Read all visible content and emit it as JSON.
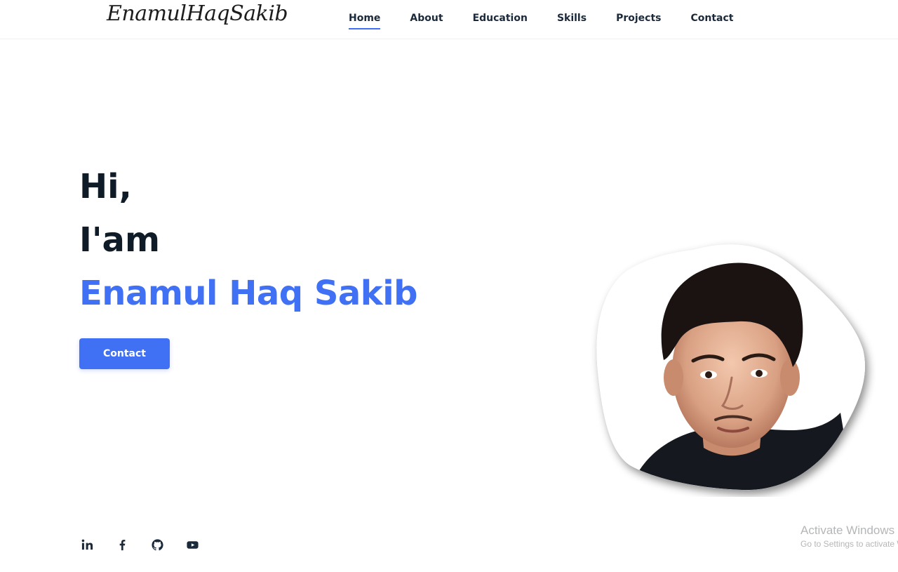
{
  "header": {
    "logo_text": "EnamulHaqSakib",
    "nav": [
      {
        "label": "Home",
        "active": true
      },
      {
        "label": "About"
      },
      {
        "label": "Education"
      },
      {
        "label": "Skills"
      },
      {
        "label": "Projects"
      },
      {
        "label": "Contact"
      }
    ]
  },
  "hero": {
    "greeting": "Hi,",
    "intro": "I'am",
    "name": "Enamul Haq Sakib",
    "contact_button": "Contact",
    "accent_color": "#4070f4"
  },
  "socials": [
    {
      "icon": "linkedin-icon",
      "label": "in"
    },
    {
      "icon": "facebook-icon",
      "label": "f"
    },
    {
      "icon": "github-icon"
    },
    {
      "icon": "youtube-icon"
    }
  ],
  "watermark": {
    "title": "Activate Windows",
    "subtitle": "Go to Settings to activate Windows."
  }
}
